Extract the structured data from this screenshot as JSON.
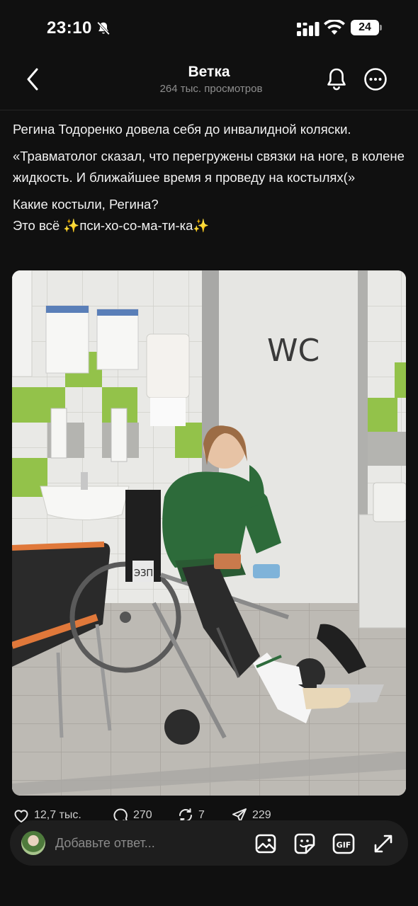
{
  "status": {
    "time": "23:10",
    "battery": "24"
  },
  "nav": {
    "title": "Ветка",
    "subtitle": "264 тыс. просмотров"
  },
  "post": {
    "line1": "Регина Тодоренко довела себя до  инвалидной коляски.",
    "quote": "«Травматолог сказал, что перегружены связки на ноге, в колене жидкость. И ближайшее время я проведу на костылях(»",
    "line3": "Какие костыли, Регина?",
    "line4": "Это всё ✨пси-хо-со-ма-ти-ка✨"
  },
  "photo": {
    "door_sign": "WC",
    "chair_label": "ЭЗП"
  },
  "actions": {
    "likes": "12,7 тыс.",
    "comments": "270",
    "reposts": "7",
    "shares": "229"
  },
  "reply": {
    "placeholder": "Добавьте ответ..."
  },
  "icons": {
    "status": [
      "bell-off-icon",
      "signal-icon",
      "wifi-icon",
      "battery-icon"
    ],
    "nav": [
      "back-arrow-icon",
      "bell-icon",
      "more-icon"
    ],
    "actions": [
      "heart-icon",
      "comment-icon",
      "repost-icon",
      "share-icon"
    ],
    "reply": [
      "image-icon",
      "sticker-icon",
      "gif-icon",
      "expand-icon"
    ]
  },
  "colors": {
    "background": "#101010",
    "text": "#f2f2f2",
    "muted": "#8e8e8e",
    "reply_bar": "#1e1e1e"
  }
}
